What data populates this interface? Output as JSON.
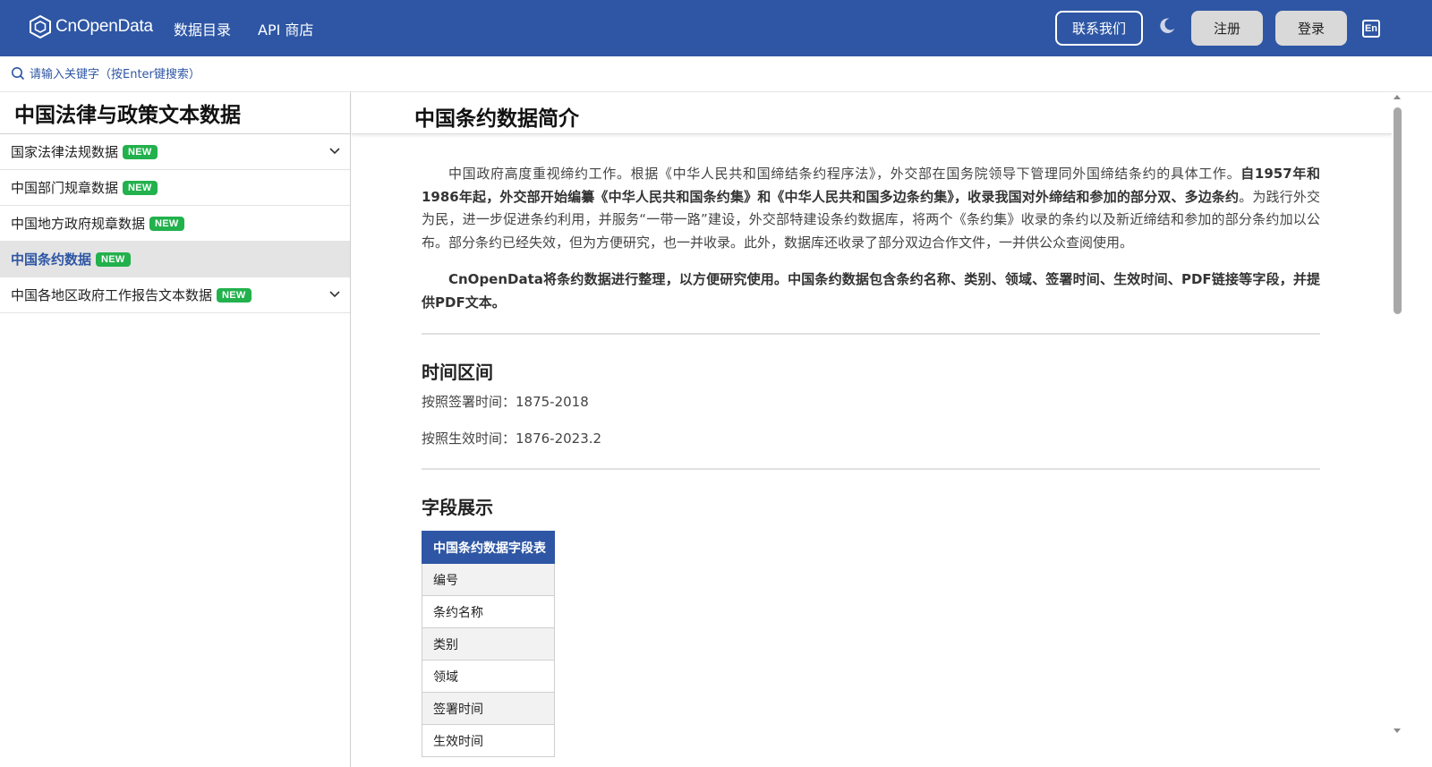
{
  "nav": {
    "logo_text": "CnOpenData",
    "links": [
      "数据目录",
      "API 商店"
    ],
    "contact": "联系我们",
    "register": "注册",
    "login": "登录",
    "lang": "En",
    "icons": [
      "hexagon-logo-icon",
      "moon-icon",
      "lang-icon"
    ]
  },
  "search": {
    "placeholder": "请输入关键字（按Enter键搜索）"
  },
  "sidebar": {
    "title": "中国法律与政策文本数据",
    "items": [
      {
        "label": "国家法律法规数据",
        "badge": "NEW",
        "expandable": true,
        "active": false
      },
      {
        "label": "中国部门规章数据",
        "badge": "NEW",
        "expandable": false,
        "active": false
      },
      {
        "label": "中国地方政府规章数据",
        "badge": "NEW",
        "expandable": false,
        "active": false
      },
      {
        "label": "中国条约数据",
        "badge": "NEW",
        "expandable": false,
        "active": true
      },
      {
        "label": "中国各地区政府工作报告文本数据",
        "badge": "NEW",
        "expandable": true,
        "active": false
      }
    ]
  },
  "main": {
    "title": "中国条约数据简介",
    "para1_a": "中国政府高度重视缔约工作。根据《中华人民共和国缔结条约程序法》，外交部在国务院领导下管理同外国缔结条约的具体工作。",
    "para1_b": "自1957年和1986年起，外交部开始编纂《中华人民共和国条约集》和《中华人民共和国多边条约集》，收录我国对外缔结和参加的部分双、多边条约",
    "para1_c": "。为践行外交为民，进一步促进条约利用，并服务“一带一路”建设，外交部特建设条约数据库，将两个《条约集》收录的条约以及新近缔结和参加的部分条约加以公布。部分条约已经失效，但为方便研究，也一并收录。此外，数据库还收录了部分双边合作文件，一并供公众查阅使用。",
    "para2": "CnOpenData将条约数据进行整理，以方便研究使用。中国条约数据包含条约名称、类别、领域、签署时间、生效时间、PDF链接等字段，并提供PDF文本。",
    "section_time": "时间区间",
    "time_sign": "按照签署时间：1875-2018",
    "time_effect": "按照生效时间：1876-2023.2",
    "section_fields": "字段展示",
    "table_header": "中国条约数据字段表",
    "fields": [
      "编号",
      "条约名称",
      "类别",
      "领域",
      "签署时间",
      "生效时间"
    ]
  },
  "colors": {
    "primary": "#2e56a4",
    "badge": "#22b14c",
    "active_bg": "#e4e4e4"
  }
}
